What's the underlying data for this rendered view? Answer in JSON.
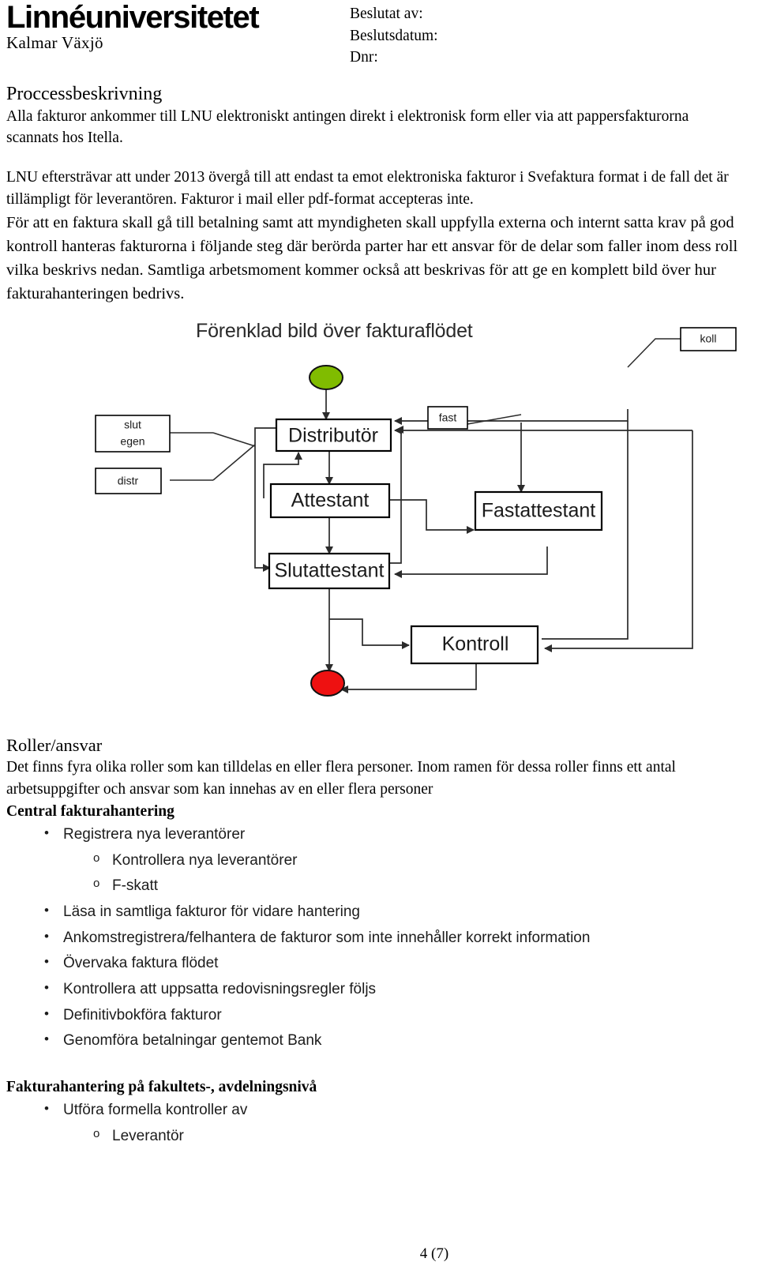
{
  "header": {
    "logo_main": "Linnéuniversitetet",
    "logo_sub": "Kalmar Växjö",
    "decision": {
      "decided_by_label": "Beslutat av:",
      "decision_date_label": "Beslutsdatum:",
      "dnr_label": "Dnr:"
    }
  },
  "main": {
    "section_title": "Proccessbeskrivning",
    "paragraph_1": "Alla fakturor ankommer till LNU elektroniskt antingen direkt i elektronisk form eller via att pappersfakturorna scannats hos Itella.",
    "paragraph_2": "LNU eftersträvar att under 2013 övergå till att endast ta emot elektroniska fakturor i Svefaktura format i de fall det är tillämpligt för leverantören. Fakturor i mail eller pdf-format accepteras inte.",
    "paragraph_3": "För att en faktura skall gå till betalning samt att myndigheten skall uppfylla externa och internt satta krav på god kontroll hanteras fakturorna i följande steg där berörda parter har ett ansvar för de delar som faller inom dess roll vilka beskrivs nedan.  Samtliga arbetsmoment kommer också att beskrivas för att ge en komplett bild över hur fakturahanteringen bedrivs."
  },
  "diagram": {
    "title": "Förenklad bild över fakturaflödet",
    "start_node_color": "#80BC00",
    "end_node_color": "#EE1111",
    "nodes": [
      {
        "id": "distributor",
        "label": "Distributör"
      },
      {
        "id": "attestant",
        "label": "Attestant"
      },
      {
        "id": "slutattestant",
        "label": "Slutattestant"
      },
      {
        "id": "fastattestant",
        "label": "Fastattestant"
      },
      {
        "id": "kontroll",
        "label": "Kontroll"
      }
    ],
    "annotations": [
      {
        "id": "slut-egen",
        "line1": "slut",
        "line2": "egen"
      },
      {
        "id": "distr",
        "line1": "distr"
      },
      {
        "id": "fast",
        "line1": "fast"
      },
      {
        "id": "koll",
        "line1": "koll"
      }
    ]
  },
  "roles": {
    "title": "Roller/ansvar",
    "intro": "Det finns fyra olika roller som kan tilldelas en eller flera personer. Inom ramen för dessa roller finns ett antal arbetsuppgifter och ansvar som kan innehas av en eller flera personer",
    "group_1_heading": "Central fakturahantering",
    "group_1_items": [
      {
        "level": 1,
        "text": "Registrera nya leverantörer"
      },
      {
        "level": 2,
        "text": "Kontrollera nya leverantörer"
      },
      {
        "level": 2,
        "text": "F-skatt"
      },
      {
        "level": 1,
        "text": "Läsa in samtliga fakturor för vidare hantering"
      },
      {
        "level": 1,
        "text": "Ankomstregistrera/felhantera de fakturor som inte innehåller korrekt information"
      },
      {
        "level": 1,
        "text": "Övervaka faktura flödet"
      },
      {
        "level": 1,
        "text": "Kontrollera att uppsatta redovisningsregler följs"
      },
      {
        "level": 1,
        "text": "Definitivbokföra fakturor"
      },
      {
        "level": 1,
        "text": "Genomföra betalningar gentemot Bank"
      }
    ],
    "group_2_heading": "Fakturahantering  på fakultets-, avdelningsnivå",
    "group_2_items": [
      {
        "level": 1,
        "text": "Utföra formella kontroller av"
      },
      {
        "level": 2,
        "text": "Leverantör"
      }
    ]
  },
  "footer": {
    "page_number": "4 (7)"
  }
}
